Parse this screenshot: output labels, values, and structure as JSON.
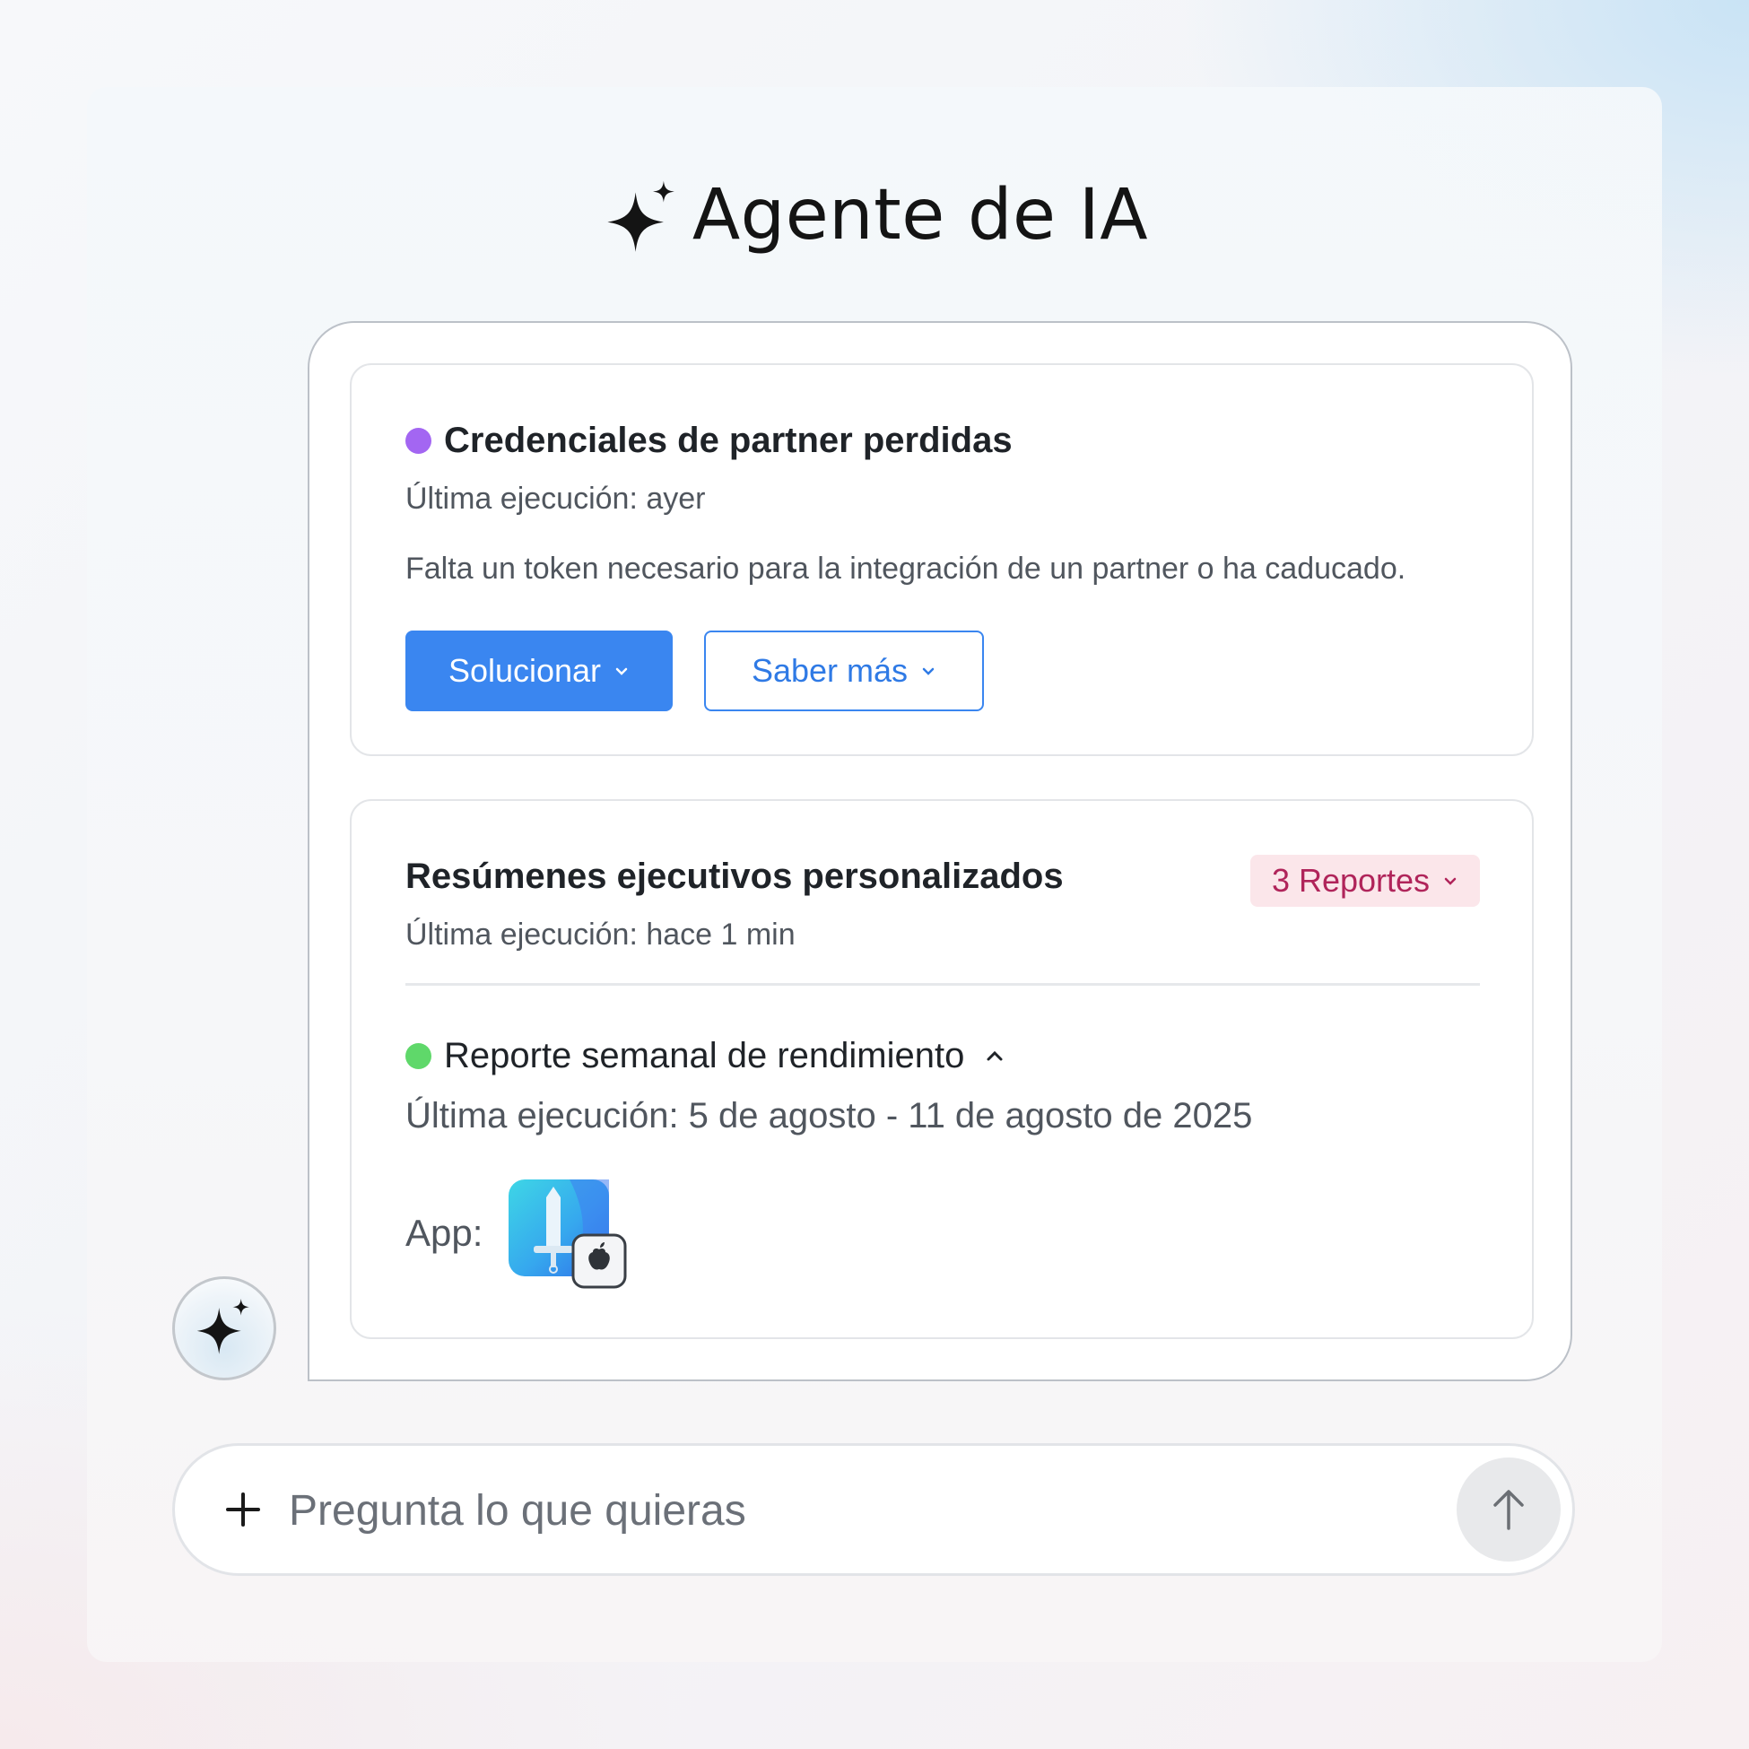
{
  "header": {
    "title": "Agente de IA",
    "icon": "sparkle-icon"
  },
  "alert_card": {
    "status_color": "#a366f2",
    "title": "Credenciales de partner perdidas",
    "last_run": "Última ejecución: ayer",
    "description": "Falta un token necesario para la integración de un partner o ha caducado.",
    "primary_button": "Solucionar",
    "secondary_button": "Saber más"
  },
  "summary_card": {
    "title": "Resúmenes ejecutivos personalizados",
    "last_run": "Última ejecución: hace 1 min",
    "badge": "3 Reportes",
    "report": {
      "status_color": "#5fd86a",
      "title": "Reporte semanal de rendimiento",
      "last_run": "Última ejecución: 5 de agosto - 11 de agosto de 2025",
      "app_label": "App:",
      "app_icon": "sword-app-icon"
    }
  },
  "composer": {
    "placeholder": "Pregunta lo que quieras",
    "add_icon": "plus-icon",
    "send_icon": "arrow-up-icon"
  },
  "colors": {
    "accent": "#3a86f0",
    "badge_bg": "#fbe6ea",
    "badge_text": "#b0245a"
  }
}
